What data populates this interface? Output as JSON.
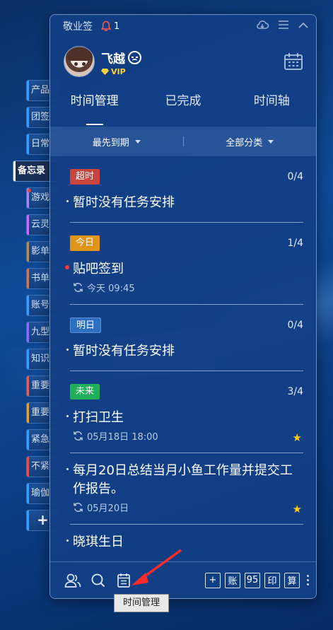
{
  "side_tabs": [
    {
      "label": "产品",
      "edge": "#3c9bff"
    },
    {
      "label": "团签",
      "edge": "#3c9bff"
    },
    {
      "label": "日常",
      "edge": "#3c9bff"
    },
    {
      "label": "备忘录",
      "edge": "#ffffff",
      "active": true
    },
    {
      "label": "游戏",
      "edge": "#9b8cf0",
      "dot": true
    },
    {
      "label": "云灵",
      "edge": "#c86cff"
    },
    {
      "label": "影单",
      "edge": "#b58a5c"
    },
    {
      "label": "书单",
      "edge": "#c87a55"
    },
    {
      "label": "账号",
      "edge": "#3c9bff"
    },
    {
      "label": "九型",
      "edge": "#8a6cff"
    },
    {
      "label": "知识",
      "edge": "#3c9bff"
    },
    {
      "label": "重要",
      "edge": "#e06060"
    },
    {
      "label": "重要",
      "edge": "#e0a040"
    },
    {
      "label": "紧急",
      "edge": "#3c9bff"
    },
    {
      "label": "不紧",
      "edge": "#e05050"
    },
    {
      "label": "瑜伽",
      "edge": "#3c9bff"
    },
    {
      "label": "+",
      "edge": "#3c9bff",
      "add": true
    }
  ],
  "titlebar": {
    "app_name": "敬业签",
    "notification_count": "1"
  },
  "profile": {
    "username": "飞越",
    "vip": "VIP"
  },
  "tabs": [
    "时间管理",
    "已完成",
    "时间轴"
  ],
  "filters": {
    "sort": "最先到期",
    "category": "全部分类"
  },
  "sections": [
    {
      "badge": "超时",
      "kind": "overdue",
      "count": "0/4",
      "items": [
        {
          "title": "暂时没有任务安排"
        }
      ]
    },
    {
      "badge": "今日",
      "kind": "today",
      "count": "1/4",
      "items": [
        {
          "title": "贴吧签到",
          "time": "今天 09:45",
          "red": true
        }
      ]
    },
    {
      "badge": "明日",
      "kind": "tomorrow",
      "count": "0/4",
      "items": [
        {
          "title": "暂时没有任务安排"
        }
      ]
    },
    {
      "badge": "未来",
      "kind": "future",
      "count": "3/4",
      "items": [
        {
          "title": "打扫卫生",
          "time": "05月18日 18:00",
          "star": true
        },
        {
          "title": "每月20日总结当月小鱼工作量并提交工作报告。",
          "time": "05月20日",
          "star": true
        },
        {
          "title": "晓琪生日"
        }
      ]
    }
  ],
  "bottom_buttons": [
    "+",
    "账",
    "95",
    "印",
    "算"
  ],
  "tooltip": "时间管理",
  "colors": {
    "panel": "#123e84",
    "accent_red": "#ff3b30",
    "star": "#ffcc1a"
  }
}
